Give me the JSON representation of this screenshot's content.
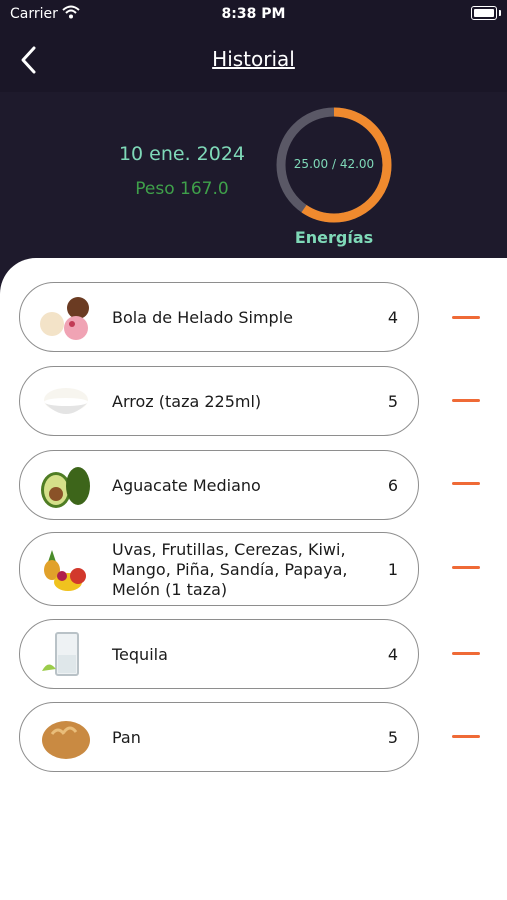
{
  "status_bar": {
    "carrier": "Carrier",
    "time": "8:38 PM"
  },
  "nav": {
    "title": "Historial",
    "back_icon": "chevron-left-icon"
  },
  "summary": {
    "date": "10 ene. 2024",
    "weight": "Peso 167.0",
    "progress_text": "25.00 / 42.00",
    "progress_value": 25.0,
    "progress_max": 42.0,
    "progress_label": "Energías"
  },
  "colors": {
    "header_bg": "#1e1a2c",
    "accent_orange": "#f08a2e",
    "teal": "#7fd9b8",
    "green": "#3fa04a",
    "ring_track": "#5a5866",
    "minus_color": "#ef6a36"
  },
  "items": [
    {
      "name": "Bola de Helado Simple",
      "qty": "4",
      "icon": "ice-cream-icon"
    },
    {
      "name": "Arroz (taza 225ml)",
      "qty": "5",
      "icon": "rice-bowl-icon"
    },
    {
      "name": "Aguacate Mediano",
      "qty": "6",
      "icon": "avocado-icon"
    },
    {
      "name": "Uvas, Frutillas, Cerezas, Kiwi, Mango, Piña, Sandía, Papaya, Melón (1 taza)",
      "qty": "1",
      "icon": "fruit-mix-icon"
    },
    {
      "name": "Tequila",
      "qty": "4",
      "icon": "tequila-glass-icon"
    },
    {
      "name": "Pan",
      "qty": "5",
      "icon": "bread-icon"
    }
  ]
}
